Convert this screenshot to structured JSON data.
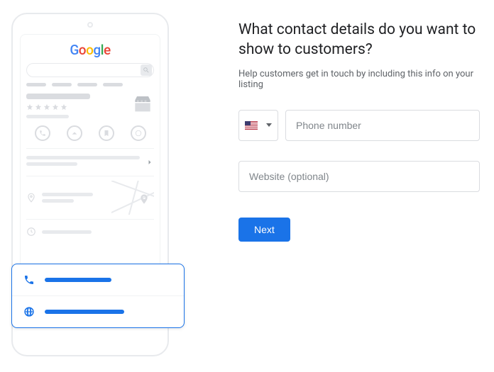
{
  "heading": "What contact details do you want to show to customers?",
  "subtext": "Help customers get in touch by including this info on your listing",
  "phone_field": {
    "placeholder": "Phone number",
    "value": ""
  },
  "website_field": {
    "placeholder": "Website (optional)",
    "value": ""
  },
  "next_label": "Next",
  "country_code": "US",
  "illustration": {
    "logo": "Google"
  }
}
